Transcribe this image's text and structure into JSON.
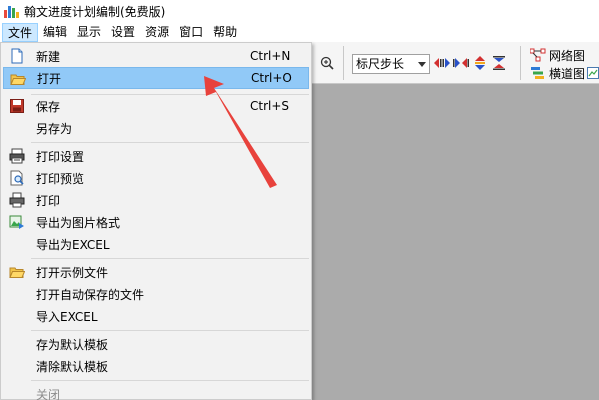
{
  "window": {
    "title": "翰文进度计划编制(免费版)"
  },
  "menubar": {
    "items": [
      "文件",
      "编辑",
      "显示",
      "设置",
      "资源",
      "窗口",
      "帮助"
    ]
  },
  "toolbar": {
    "step_select": "标尺步长",
    "network_label": "网络图",
    "gantt_label": "横道图"
  },
  "file_menu": {
    "new": {
      "label": "新建",
      "shortcut": "Ctrl+N"
    },
    "open": {
      "label": "打开",
      "shortcut": "Ctrl+O"
    },
    "save": {
      "label": "保存",
      "shortcut": "Ctrl+S"
    },
    "save_as": {
      "label": "另存为"
    },
    "print_setup": {
      "label": "打印设置"
    },
    "print_preview": {
      "label": "打印预览"
    },
    "print": {
      "label": "打印"
    },
    "export_image": {
      "label": "导出为图片格式"
    },
    "export_excel": {
      "label": "导出为EXCEL"
    },
    "open_example": {
      "label": "打开示例文件"
    },
    "open_autosave": {
      "label": "打开自动保存的文件"
    },
    "import_excel": {
      "label": "导入EXCEL"
    },
    "save_default_template": {
      "label": "存为默认模板"
    },
    "clear_default_template": {
      "label": "清除默认模板"
    },
    "close": {
      "label": "关闭"
    }
  },
  "colors": {
    "highlight": "#91c9f7",
    "workspace": "#ababab",
    "annotation_arrow": "#e8423c"
  }
}
